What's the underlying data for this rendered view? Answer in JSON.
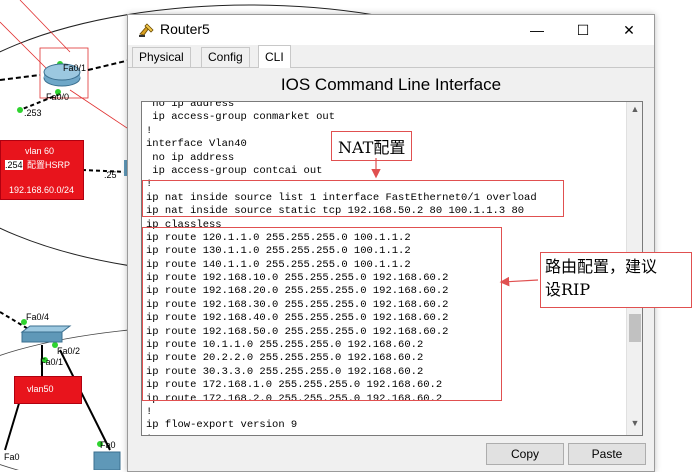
{
  "window": {
    "title": "Router5",
    "minimize_glyph": "—",
    "maximize_glyph": "☐",
    "close_glyph": "✕"
  },
  "tabs": [
    {
      "label": "Physical",
      "active": false
    },
    {
      "label": "Config",
      "active": false
    },
    {
      "label": "CLI",
      "active": true
    }
  ],
  "cli": {
    "heading": "IOS Command Line Interface",
    "lines": [
      " no ip address",
      " ip access-group conmarket out",
      "!",
      "interface Vlan40",
      " no ip address",
      " ip access-group contcai out",
      "!",
      "ip nat inside source list 1 interface FastEthernet0/1 overload",
      "ip nat inside source static tcp 192.168.50.2 80 100.1.1.3 80",
      "ip classless",
      "ip route 120.1.1.0 255.255.255.0 100.1.1.2",
      "ip route 130.1.1.0 255.255.255.0 100.1.1.2",
      "ip route 140.1.1.0 255.255.255.0 100.1.1.2",
      "ip route 192.168.10.0 255.255.255.0 192.168.60.2",
      "ip route 192.168.20.0 255.255.255.0 192.168.60.2",
      "ip route 192.168.30.0 255.255.255.0 192.168.60.2",
      "ip route 192.168.40.0 255.255.255.0 192.168.60.2",
      "ip route 192.168.50.0 255.255.255.0 192.168.60.2",
      "ip route 10.1.1.0 255.255.255.0 192.168.60.2",
      "ip route 20.2.2.0 255.255.255.0 192.168.60.2",
      "ip route 30.3.3.0 255.255.255.0 192.168.60.2",
      "ip route 172.168.1.0 255.255.255.0 192.168.60.2",
      "ip route 172.168.2.0 255.255.255.0 192.168.60.2",
      "!",
      "ip flow-export version 9",
      "!"
    ]
  },
  "buttons": {
    "copy": "Copy",
    "paste": "Paste"
  },
  "annotations": {
    "nat": "NAT配置",
    "route_line1": "路由配置，建议",
    "route_line2": "设RIP",
    "color": "#e05050"
  },
  "topology": {
    "router_port_top": "Fa0/1",
    "router_port_bottom": "Fa0/0",
    "ip_253": ".253",
    "vlan60_line1": "vlan 60",
    "vlan60_ip": ".254",
    "vlan60_line2": "配置HSRP",
    "vlan60_subnet": "192.168.60.0/24",
    "ip_25": ".25",
    "switch_port_fa04": "Fa0/4",
    "switch_port_fa02": "Fa0/2",
    "switch_port_fa01": "Fa0/1",
    "vlan50": "vlan50",
    "bottom_port_left": "Fa0",
    "bottom_port_right": "Fa0",
    "vlan_box_color": "#e8141c"
  }
}
